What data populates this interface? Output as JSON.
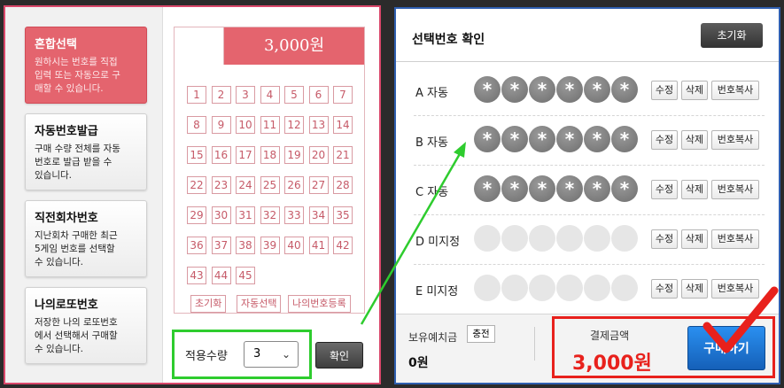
{
  "left_menu": [
    {
      "title": "혼합선택",
      "desc_lines": [
        "원하시는 번호를 직접",
        "입력 또는 자동으로 구",
        "매할 수 있습니다."
      ],
      "active": true
    },
    {
      "title": "자동번호발급",
      "desc_lines": [
        "구매 수량 전체를 자동",
        "번호로 발급 받을 수",
        "있습니다."
      ],
      "active": false
    },
    {
      "title": "직전회차번호",
      "desc_lines": [
        "지난회차 구매한 최근",
        "5게임 번호를 선택할",
        "수 있습니다."
      ],
      "active": false
    },
    {
      "title": "나의로또번호",
      "desc_lines": [
        "저장한 나의 로또번호",
        "에서 선택해서 구매할",
        "수 있습니다."
      ],
      "active": false
    }
  ],
  "price": "3,000원",
  "numbers": [
    "1",
    "2",
    "3",
    "4",
    "5",
    "6",
    "7",
    "8",
    "9",
    "10",
    "11",
    "12",
    "13",
    "14",
    "15",
    "16",
    "17",
    "18",
    "19",
    "20",
    "21",
    "22",
    "23",
    "24",
    "25",
    "26",
    "27",
    "28",
    "29",
    "30",
    "31",
    "32",
    "33",
    "34",
    "35",
    "36",
    "37",
    "38",
    "39",
    "40",
    "41",
    "42",
    "43",
    "44",
    "45"
  ],
  "grid_buttons": {
    "reset": "초기화",
    "auto": "자동선택",
    "my": "나의번호등록"
  },
  "quantity": {
    "label": "적용수량",
    "value": "3"
  },
  "confirm_label": "확인",
  "right": {
    "title": "선택번호 확인",
    "reset_label": "초기화",
    "rows": [
      {
        "label": "A 자동",
        "filled": true
      },
      {
        "label": "B 자동",
        "filled": true
      },
      {
        "label": "C 자동",
        "filled": true
      },
      {
        "label": "D 미지정",
        "filled": false
      },
      {
        "label": "E 미지정",
        "filled": false
      }
    ],
    "ball_symbol": "*",
    "row_buttons": {
      "edit": "수정",
      "delete": "삭제",
      "copy": "번호복사"
    },
    "balance_label": "보유예치금",
    "charge_label": "충전",
    "balance_value": "0원",
    "pay_label": "결제금액",
    "pay_value": "3,000원",
    "buy_label": "구매하기"
  },
  "colors": {
    "accent_red": "#e4646e",
    "highlight_green": "#2ecc2e",
    "highlight_red": "#e8211c",
    "buy_blue": "#1f78d6"
  }
}
